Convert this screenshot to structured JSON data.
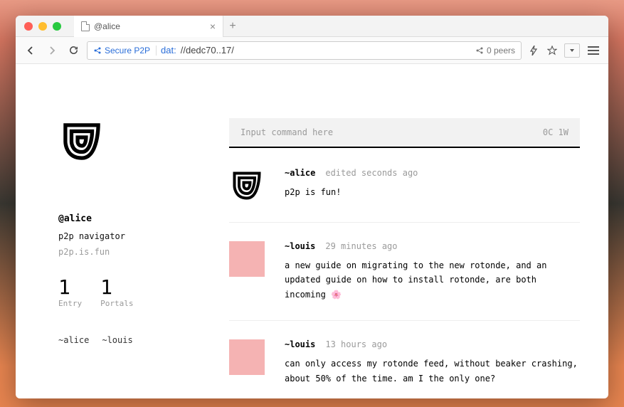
{
  "window": {
    "tab_title": "@alice"
  },
  "toolbar": {
    "secure_label": "Secure P2P",
    "url_scheme": "dat:",
    "url_path": "//dedc70..17/",
    "peers_label": "0 peers"
  },
  "profile": {
    "handle": "@alice",
    "bio": "p2p navigator",
    "domain": "p2p.is.fun",
    "stats": [
      {
        "value": "1",
        "label": "Entry"
      },
      {
        "value": "1",
        "label": "Portals"
      }
    ],
    "follows": [
      "~alice",
      "~louis"
    ]
  },
  "command": {
    "placeholder": "Input command here",
    "counter": "0C 1W"
  },
  "feed": [
    {
      "avatar": "logo",
      "author": "~alice",
      "meta": "edited seconds ago",
      "text": "p2p is fun!"
    },
    {
      "avatar": "pink",
      "author": "~louis",
      "meta": "29 minutes ago",
      "text": "a new guide on migrating to the new rotonde, and an updated guide on how to install rotonde, are both incoming 🌸"
    },
    {
      "avatar": "pink",
      "author": "~louis",
      "meta": "13 hours ago",
      "text": "can only access my rotonde feed, without beaker crashing, about 50% of the time. am I the only one?"
    }
  ]
}
